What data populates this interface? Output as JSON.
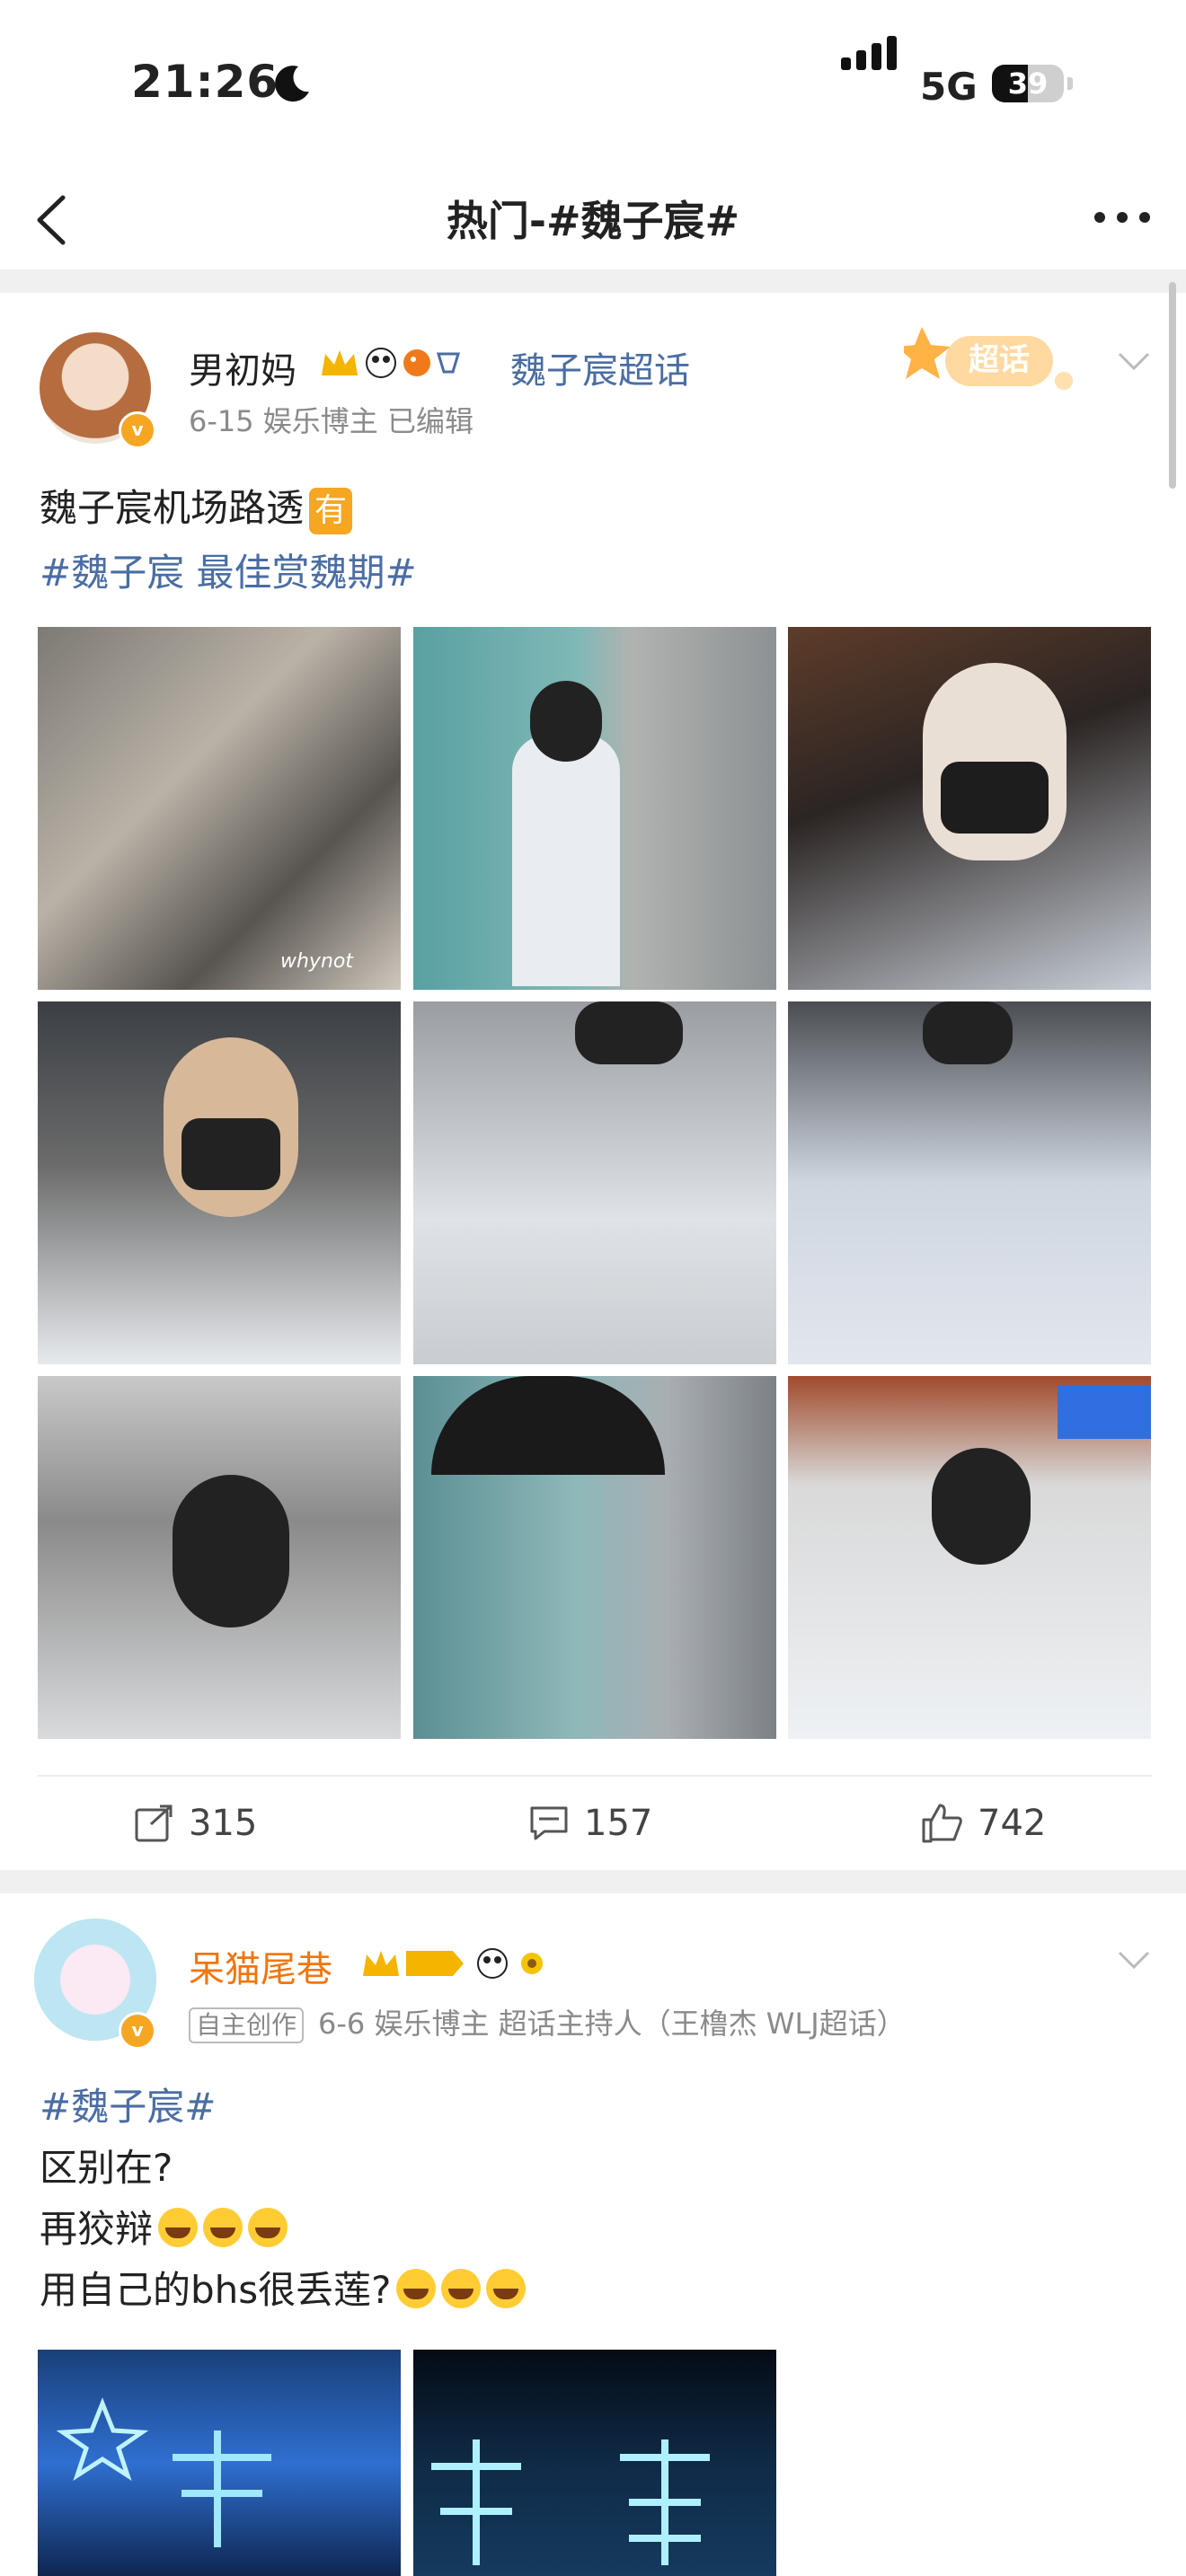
{
  "status_bar": {
    "time": "21:26",
    "network": "5G",
    "battery": "39"
  },
  "nav": {
    "title": "热门-#魏子宸#"
  },
  "posts": [
    {
      "username": "男初妈",
      "topic": "魏子宸超话",
      "meta": "6-15  娱乐博主  已编辑",
      "badge_label": "超话",
      "text_main": "魏子宸机场路透",
      "text_tag_label": "有",
      "hashtag_line": "#魏子宸 最佳赏魏期#",
      "photos": [
        {
          "label": "whynot"
        },
        {
          "label": ""
        },
        {
          "label": ""
        },
        {
          "label": ""
        },
        {
          "label": ""
        },
        {
          "label": ""
        },
        {
          "label": ""
        },
        {
          "label": ""
        },
        {
          "label": ""
        }
      ],
      "repost_count": "315",
      "comment_count": "157",
      "like_count": "742"
    },
    {
      "username": "呆猫尾巷",
      "chip": "自主创作",
      "meta": "6-6  娱乐博主  超话主持人（王橹杰 WLJ超话）",
      "lines": [
        "#魏子宸#",
        "区别在?",
        "再狡辩",
        "用自己的bhs很丢莲?"
      ]
    }
  ],
  "colors": {
    "link": "#4a6da3",
    "orange": "#f0760d",
    "badge": "#f5a623"
  }
}
